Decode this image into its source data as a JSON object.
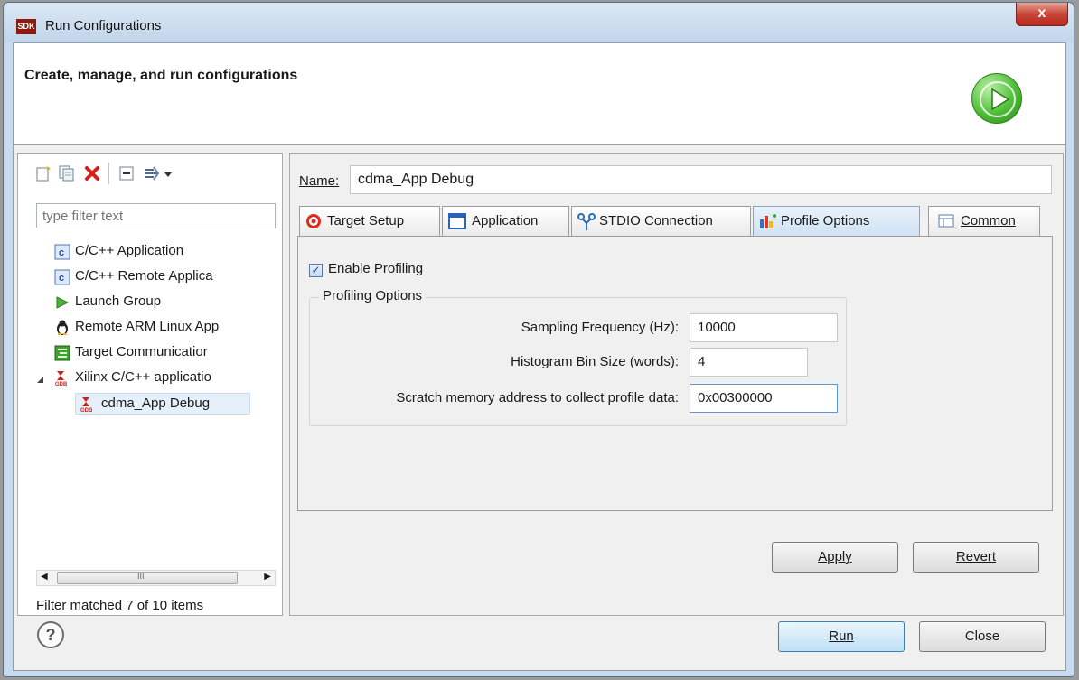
{
  "window": {
    "title": "Run Configurations",
    "logo_text": "SDK",
    "close_glyph": "x"
  },
  "header": {
    "title": "Create, manage, and run configurations",
    "icon": "run-play-icon"
  },
  "left_panel": {
    "toolbar_icons": [
      "new-config-icon",
      "duplicate-icon",
      "delete-icon",
      "collapse-all-icon",
      "filter-icon",
      "dropdown-arrow-icon"
    ],
    "filter_placeholder": "type filter text",
    "tree": [
      {
        "label": "C/C++ Application",
        "icon": "c-file-icon",
        "level": 0
      },
      {
        "label": "C/C++ Remote Applica",
        "icon": "c-file-icon",
        "level": 0
      },
      {
        "label": "Launch Group",
        "icon": "launch-group-icon",
        "level": 0
      },
      {
        "label": "Remote ARM Linux App",
        "icon": "linux-penguin-icon",
        "level": 0
      },
      {
        "label": "Target Communicatior",
        "icon": "target-comm-icon",
        "level": 0
      },
      {
        "label": "Xilinx C/C++ applicatio",
        "icon": "xilinx-gdb-icon",
        "level": 0,
        "expanded": true
      },
      {
        "label": "cdma_App Debug",
        "icon": "xilinx-gdb-icon",
        "level": 1,
        "selected": true
      }
    ],
    "filter_status": "Filter matched 7 of 10 items",
    "hscroll_thumb_glyph": "III"
  },
  "right_panel": {
    "name_label": "Name:",
    "name_value": "cdma_App Debug",
    "tabs": [
      {
        "label": "Target Setup",
        "icon": "target-icon"
      },
      {
        "label": "Application",
        "icon": "application-icon"
      },
      {
        "label": "STDIO Connection",
        "icon": "stdio-icon"
      },
      {
        "label": "Profile Options",
        "icon": "profile-icon",
        "active": true
      },
      {
        "label": "Common",
        "icon": "common-icon"
      }
    ],
    "enable_profiling_label": "Enable Profiling",
    "enable_profiling_checked": true,
    "group_title": "Profiling Options",
    "fields": [
      {
        "label": "Sampling Frequency (Hz):",
        "value": "10000"
      },
      {
        "label": "Histogram Bin Size (words):",
        "value": "4"
      },
      {
        "label": "Scratch memory address to collect profile data:",
        "value": "0x00300000"
      }
    ],
    "apply_label": "Apply",
    "revert_label": "Revert"
  },
  "footer": {
    "help_glyph": "?",
    "run_label": "Run",
    "close_label": "Close"
  },
  "colors": {
    "titlebar": "#c2d6eb",
    "close_button": "#c8463a",
    "run_icon": "#4ebd35",
    "selection": "#e5f0fb"
  }
}
